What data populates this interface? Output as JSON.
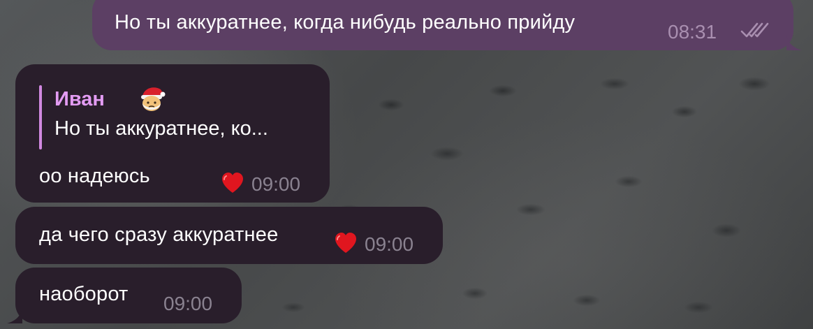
{
  "messages": [
    {
      "direction": "outgoing",
      "text": "Но ты аккуратнее, когда нибудь реально прийду",
      "time": "08:31",
      "status_icon": "double-check-icon"
    },
    {
      "direction": "incoming",
      "reply": {
        "author": "Иван",
        "author_emoji": "santa-face-emoji",
        "text": "Но ты аккуратнее, ко..."
      },
      "text": "оо надеюсь",
      "time": "09:00",
      "reaction": "heart-icon"
    },
    {
      "direction": "incoming",
      "text": "да чего сразу аккуратнее",
      "time": "09:00",
      "reaction": "heart-icon"
    },
    {
      "direction": "incoming",
      "text": "наоборот",
      "time": "09:00"
    }
  ],
  "colors": {
    "outgoing_bubble": "#5c3f64",
    "incoming_bubble": "#291e2b",
    "reply_author": "#e39cf3",
    "heart": "#e0161f"
  }
}
